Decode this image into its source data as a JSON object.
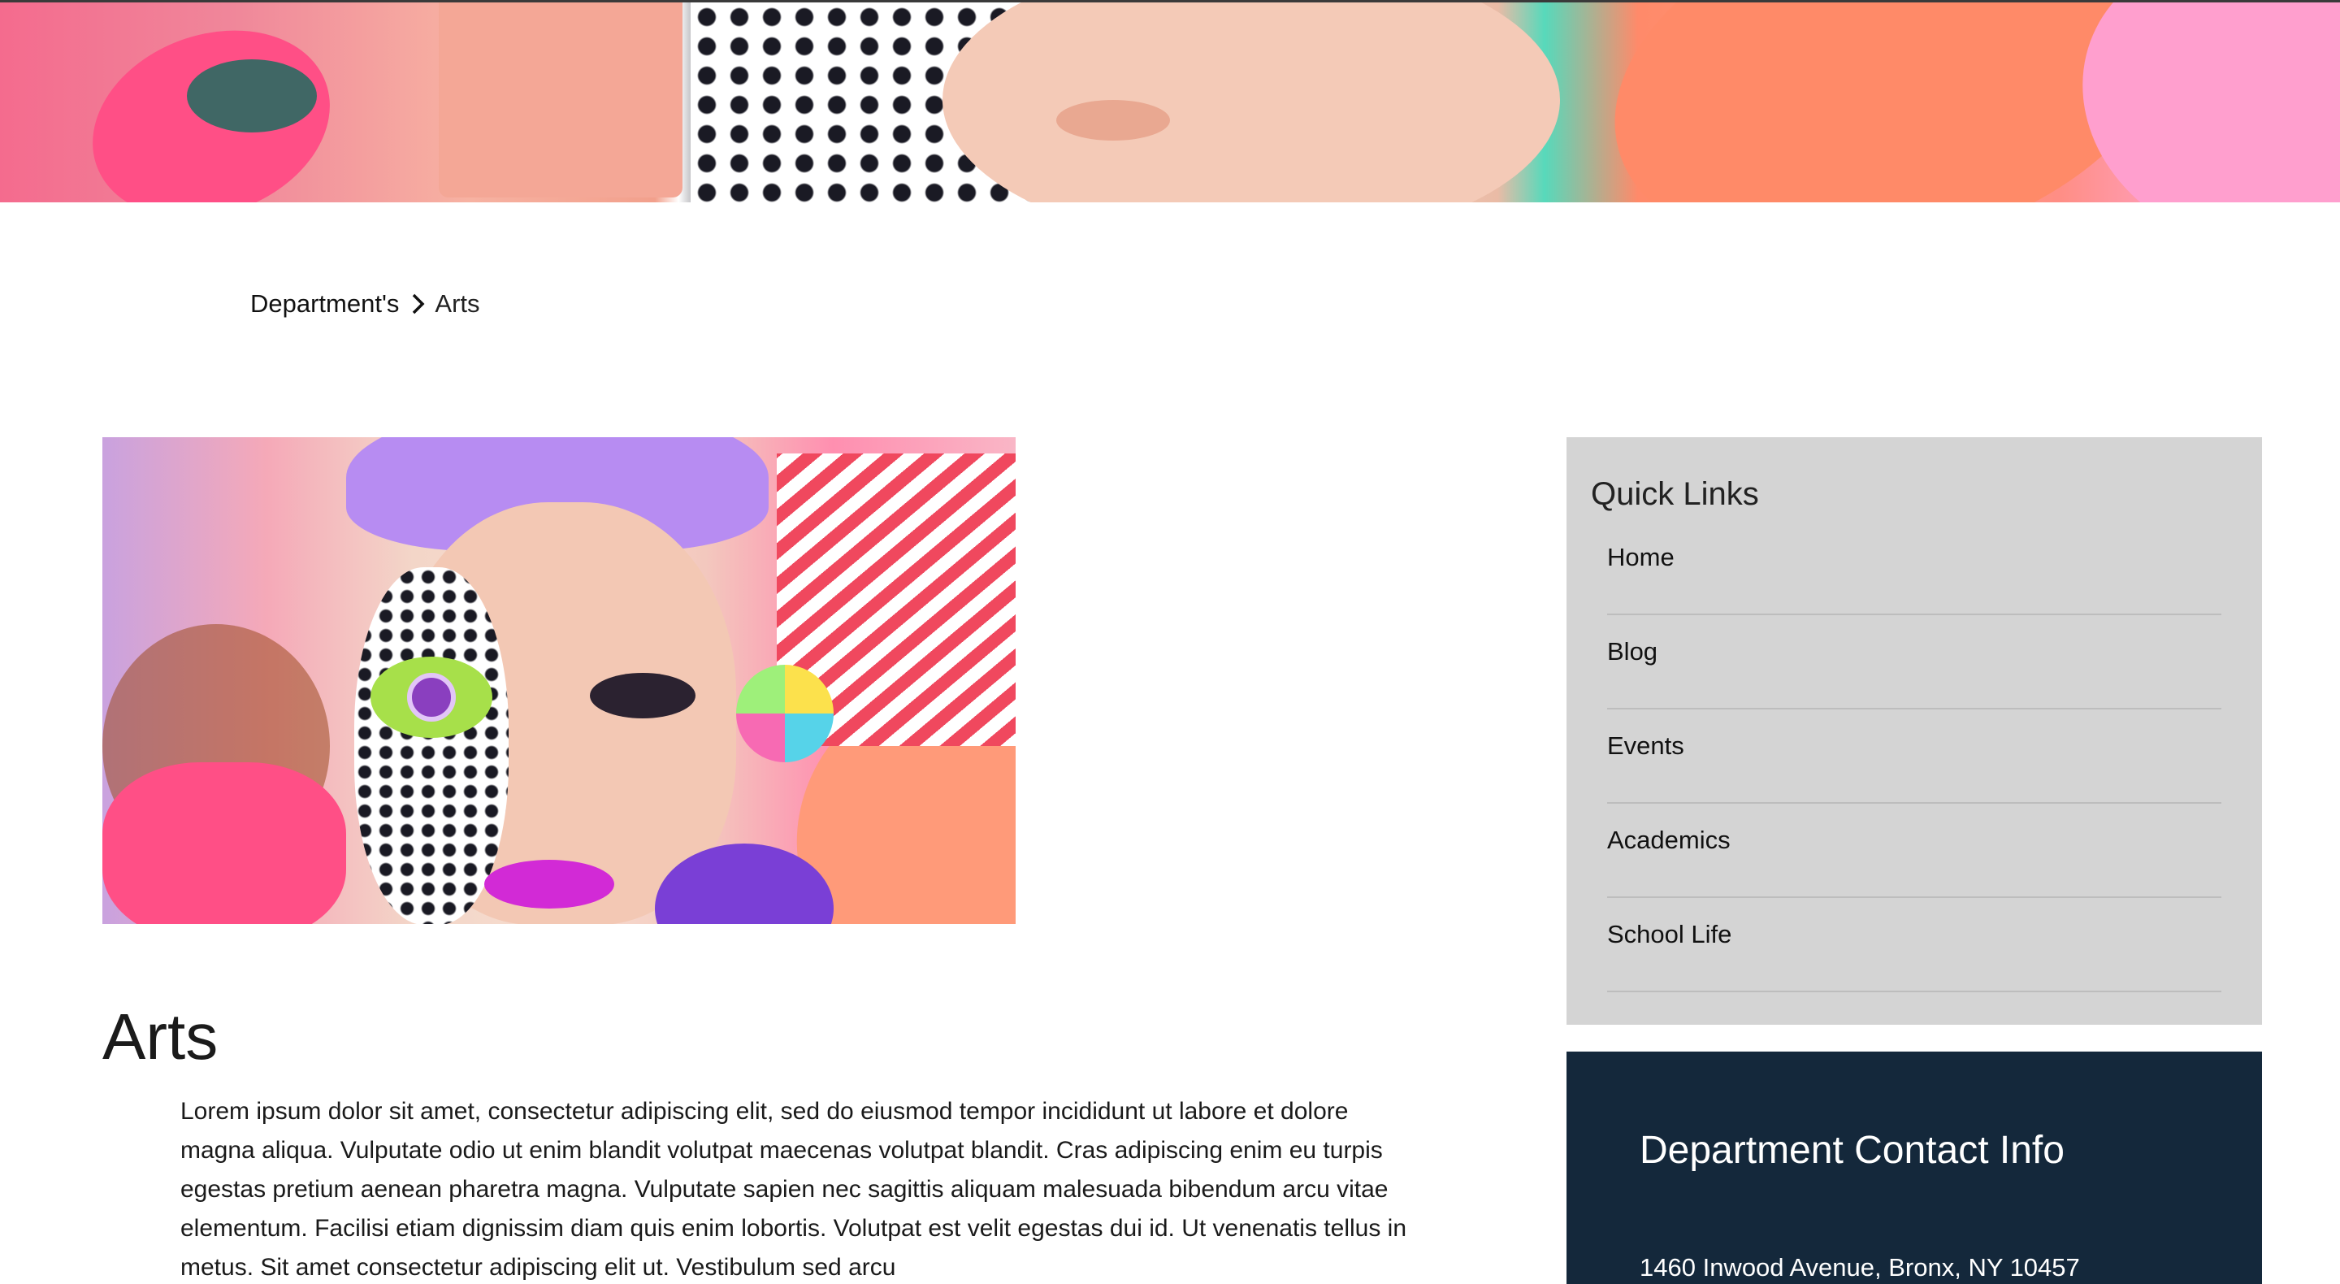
{
  "breadcrumb": {
    "parent": "Department's",
    "separator_icon": "chevron-right-icon",
    "current": "Arts"
  },
  "article": {
    "title": "Arts",
    "body": "Lorem ipsum dolor sit amet, consectetur adipiscing elit, sed do eiusmod tempor incididunt ut labore et dolore magna aliqua. Vulputate odio ut enim blandit volutpat maecenas volutpat blandit. Cras adipiscing enim eu turpis egestas pretium aenean pharetra magna. Vulputate sapien nec sagittis aliquam malesuada bibendum arcu vitae elementum. Facilisi etiam dignissim diam quis enim lobortis. Volutpat est velit egestas dui id. Ut venenatis tellus in metus. Sit amet consectetur adipiscing elit ut. Vestibulum sed arcu"
  },
  "quick_links": {
    "title": "Quick Links",
    "items": [
      {
        "label": "Home"
      },
      {
        "label": "Blog"
      },
      {
        "label": "Events"
      },
      {
        "label": "Academics"
      },
      {
        "label": "School Life"
      }
    ]
  },
  "contact": {
    "title": "Department Contact Info",
    "address": "1460 Inwood Avenue, Bronx, NY 10457"
  },
  "colors": {
    "sidebar_bg": "#d4d4d4",
    "contact_bg": "#14283b",
    "text": "#111111"
  }
}
